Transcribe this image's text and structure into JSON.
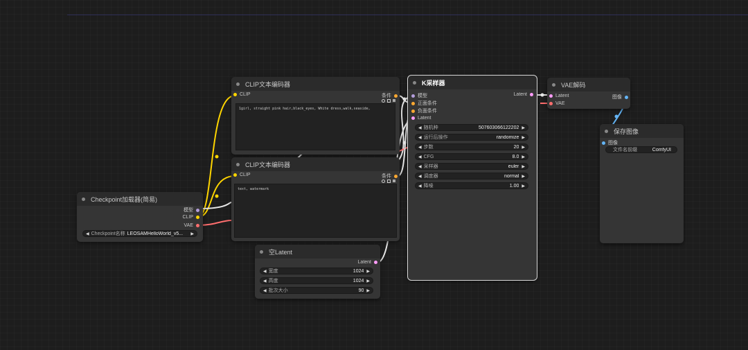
{
  "colors": {
    "model": "#b39ddb",
    "clip": "#ffd500",
    "vae": "#ff6e6e",
    "conditioning": "#ffa931",
    "latent": "#ff9cf9",
    "image": "#64b5f6",
    "link_white": "#e8e8e8"
  },
  "nodes": {
    "checkpoint": {
      "title": "Checkpoint加载器(简易)",
      "outputs": [
        "模型",
        "CLIP",
        "VAE"
      ],
      "widget": {
        "label": "Checkpoint名称",
        "value": "LEOSAMHelloWorld_v5..."
      }
    },
    "clip_pos": {
      "title": "CLIP文本编码器",
      "input": "CLIP",
      "output": "条件",
      "text": "1girl, straight pink hair,black_eyes, White dress,walk,seaside,"
    },
    "clip_neg": {
      "title": "CLIP文本编码器",
      "input": "CLIP",
      "output": "条件",
      "text": "text, watermark"
    },
    "empty_latent": {
      "title": "空Latent",
      "output": "Latent",
      "widgets": [
        {
          "label": "宽度",
          "value": "1024"
        },
        {
          "label": "高度",
          "value": "1024"
        },
        {
          "label": "批次大小",
          "value": "90"
        }
      ]
    },
    "ksampler": {
      "title": "K采样器",
      "inputs": [
        "模型",
        "正面条件",
        "负面条件",
        "Latent"
      ],
      "output": "Latent",
      "widgets": [
        {
          "label": "随机种",
          "value": "507603066122202"
        },
        {
          "label": "运行后操作",
          "value": "randomize"
        },
        {
          "label": "步数",
          "value": "20"
        },
        {
          "label": "CFG",
          "value": "8.0"
        },
        {
          "label": "采样器",
          "value": "euler"
        },
        {
          "label": "调度器",
          "value": "normal"
        },
        {
          "label": "降噪",
          "value": "1.00"
        }
      ]
    },
    "vae_decode": {
      "title": "VAE解码",
      "inputs": [
        "Latent",
        "VAE"
      ],
      "output": "图像"
    },
    "save_image": {
      "title": "保存图像",
      "input": "图像",
      "widget": {
        "label": "文件名前缀",
        "value": "ComfyUI"
      }
    }
  }
}
